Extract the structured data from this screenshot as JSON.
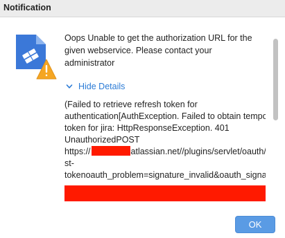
{
  "window": {
    "title": "Notification"
  },
  "icons": {
    "app": "document-with-warning-icon",
    "toggle": "chevron-down-icon"
  },
  "message": {
    "text": "Oops Unable to get the authorization URL for the given webservice. Please contact your administrator"
  },
  "details": {
    "toggle_label": "Hide Details",
    "lines": [
      "(Failed to retrieve refresh token for",
      "authentication[AuthException. Failed to obtain temporary",
      "token for jira: HttpResponseException. 401",
      "UnauthorizedPOST",
      "https://",
      "atlassian.net//plugins/servlet/oauth/reque",
      "st-",
      "tokenoauth_problem=signature_invalid&oauth_signature=E"
    ]
  },
  "buttons": {
    "ok_label": "OK"
  },
  "colors": {
    "accent": "#2b7bd6",
    "button": "#5a9be4",
    "redaction": "#ff1a00",
    "warning": "#f5a623",
    "document": "#3b78d8"
  }
}
